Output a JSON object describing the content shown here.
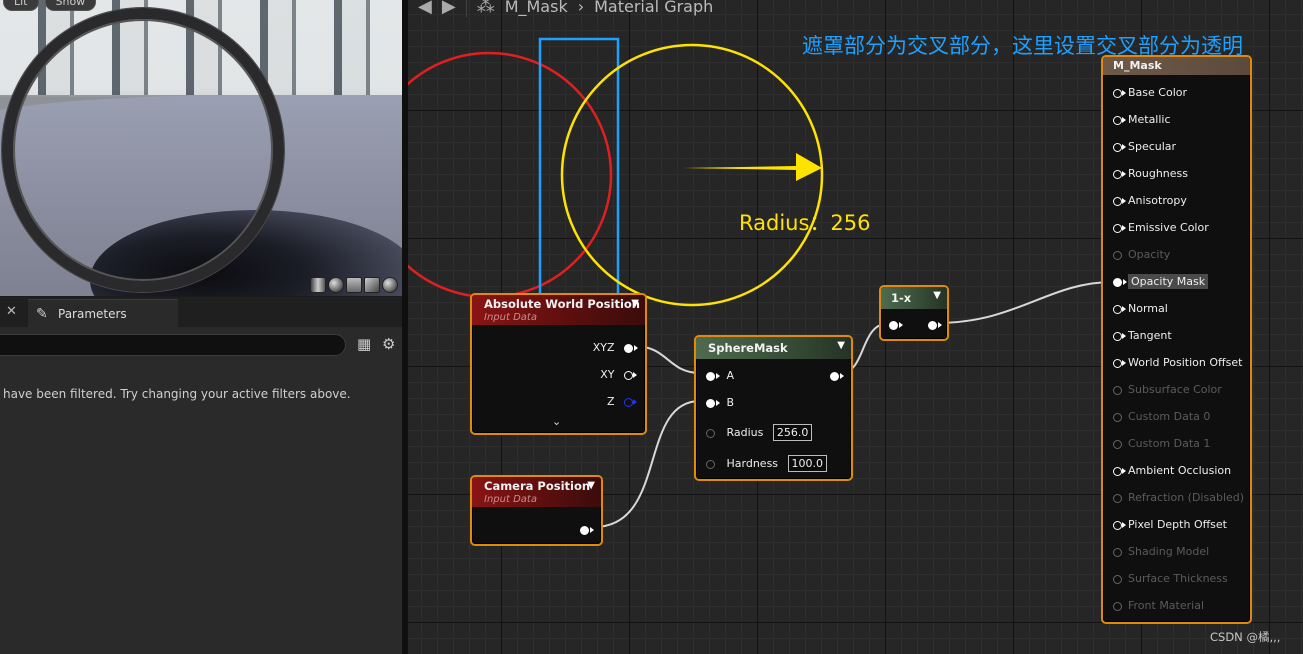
{
  "viewport": {
    "chips": [
      "Lit",
      "Show"
    ]
  },
  "parameters_panel": {
    "tab_label": "Parameters",
    "filtered_message": "have been filtered. Try changing your active filters above."
  },
  "breadcrumb": {
    "asset": "M_Mask",
    "graph": "Material Graph"
  },
  "nodes": {
    "absolute_world_position": {
      "title": "Absolute World Position",
      "subtitle": "Input Data",
      "outputs": [
        "XYZ",
        "XY",
        "Z"
      ]
    },
    "camera_position": {
      "title": "Camera Position",
      "subtitle": "Input Data"
    },
    "sphere_mask": {
      "title": "SphereMask",
      "input_a": "A",
      "input_b": "B",
      "radius_label": "Radius",
      "radius_value": "256.0",
      "hardness_label": "Hardness",
      "hardness_value": "100.0"
    },
    "one_minus": {
      "title": "1-x"
    }
  },
  "result_node": {
    "title": "M_Mask",
    "pins": [
      {
        "label": "Base Color",
        "enabled": true
      },
      {
        "label": "Metallic",
        "enabled": true
      },
      {
        "label": "Specular",
        "enabled": true
      },
      {
        "label": "Roughness",
        "enabled": true
      },
      {
        "label": "Anisotropy",
        "enabled": true
      },
      {
        "label": "Emissive Color",
        "enabled": true
      },
      {
        "label": "Opacity",
        "enabled": false
      },
      {
        "label": "Opacity Mask",
        "enabled": true,
        "connected": true
      },
      {
        "label": "Normal",
        "enabled": true
      },
      {
        "label": "Tangent",
        "enabled": true
      },
      {
        "label": "World Position Offset",
        "enabled": true
      },
      {
        "label": "Subsurface Color",
        "enabled": false
      },
      {
        "label": "Custom Data 0",
        "enabled": false
      },
      {
        "label": "Custom Data 1",
        "enabled": false
      },
      {
        "label": "Ambient Occlusion",
        "enabled": true
      },
      {
        "label": "Refraction (Disabled)",
        "enabled": false
      },
      {
        "label": "Pixel Depth Offset",
        "enabled": true
      },
      {
        "label": "Shading Model",
        "enabled": false
      },
      {
        "label": "Surface Thickness",
        "enabled": false
      },
      {
        "label": "Front Material",
        "enabled": false
      }
    ]
  },
  "annotations": {
    "mask_note": "遮罩部分为交叉部分，这里设置交叉部分为透明",
    "radius_note": "Radius：256"
  },
  "watermark": "CSDN @橘,,,",
  "colors": {
    "node_border": "#e08a0c",
    "annotation_red": "#e02020",
    "annotation_yellow": "#ffe300",
    "annotation_blue": "#1ea0ff"
  }
}
